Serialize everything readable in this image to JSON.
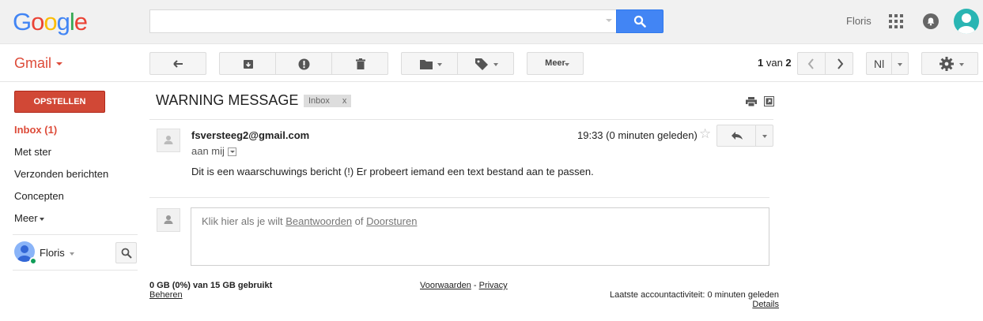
{
  "header": {
    "logo_letters": [
      "G",
      "o",
      "o",
      "g",
      "l",
      "e"
    ],
    "search": {
      "value": "",
      "placeholder": ""
    },
    "user_name": "Floris"
  },
  "toolbar": {
    "gmail_label": "Gmail",
    "more_label": "Meer",
    "page_current": "1",
    "page_sep": " van ",
    "page_total": "2",
    "language_label": "Nl"
  },
  "sidebar": {
    "compose_label": "OPSTELLEN",
    "items": [
      {
        "label": "Inbox (1)",
        "active": true
      },
      {
        "label": "Met ster"
      },
      {
        "label": "Verzonden berichten"
      },
      {
        "label": "Concepten"
      },
      {
        "label": "Meer"
      }
    ],
    "hangouts_user": "Floris"
  },
  "message": {
    "subject": "WARNING MESSAGE",
    "label": "Inbox",
    "label_remove": "x",
    "sender": "fsversteeg2@gmail.com",
    "to": "aan mij",
    "time": "19:33 (0 minuten geleden)",
    "body": "Dit is een waarschuwings bericht (!) Er probeert iemand een text bestand aan te passen.",
    "reply_hint_prefix": "Klik hier als je wilt ",
    "reply_link": "Beantwoorden",
    "reply_hint_mid": " of ",
    "forward_link": "Doorsturen"
  },
  "footer": {
    "quota": "0 GB (0%) van 15 GB gebruikt",
    "manage": "Beheren",
    "terms": "Voorwaarden",
    "separator": " - ",
    "privacy": "Privacy",
    "activity": "Laatste accountactiviteit: 0 minuten geleden",
    "details": "Details"
  },
  "colors": {
    "accent_red": "#dd4b39",
    "compose_red": "#d14836",
    "search_blue": "#4285f4"
  }
}
